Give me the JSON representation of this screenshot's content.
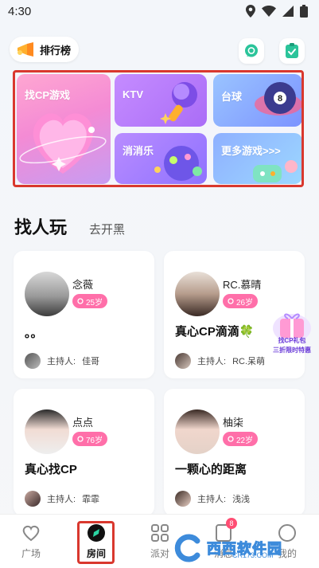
{
  "status_bar": {
    "time": "4:30"
  },
  "header": {
    "rank_label": "排行榜"
  },
  "games": {
    "cp": "找CP游戏",
    "ktv": "KTV",
    "billiards": "台球",
    "xiaoxiaole": "消消乐",
    "more": "更多游戏>>>"
  },
  "section": {
    "title": "找人玩",
    "subtitle": "去开黑"
  },
  "rooms": [
    {
      "name": "念薇",
      "age": "25岁",
      "title": "。。",
      "host_prefix": "主持人:",
      "host": "佳哥"
    },
    {
      "name": "RC.慕晴",
      "age": "26岁",
      "title": "真心CP滴滴🍀",
      "host_prefix": "主持人:",
      "host": "RC.呆萌"
    },
    {
      "name": "点点",
      "age": "76岁",
      "title": "真心找CP",
      "host_prefix": "主持人:",
      "host": "霏霏"
    },
    {
      "name": "柚柒",
      "age": "22岁",
      "title": "一颗心的距离",
      "host_prefix": "主持人:",
      "host": "浅浅"
    }
  ],
  "promo": {
    "line1": "找CP礼包",
    "line2": "三折限时特惠"
  },
  "bottom_nav": {
    "plaza": "广场",
    "room": "房间",
    "party": "派对",
    "message": "消息",
    "mine": "我的",
    "message_badge": "8"
  },
  "watermark": {
    "text": "西西软件园",
    "url": "CR173.COM"
  },
  "colors": {
    "accent_pink": "#ff6fa9",
    "highlight_red": "#d9382e",
    "badge": "#ff4d73"
  }
}
